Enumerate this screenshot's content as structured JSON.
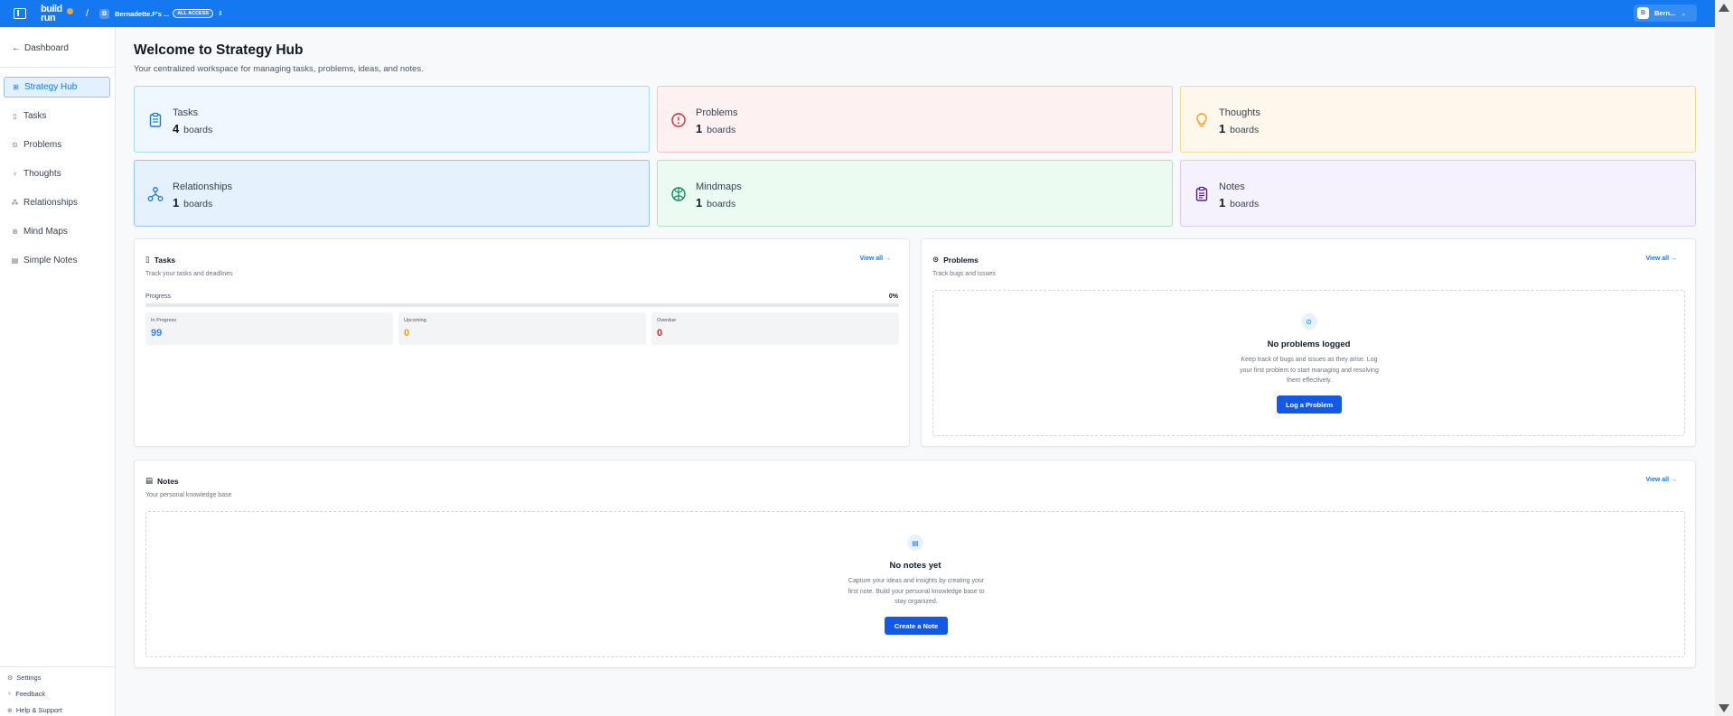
{
  "topbar": {
    "logo_line1": "build",
    "logo_line2": "run",
    "separator": "/",
    "workspace_initial": "B",
    "workspace_name": "Bernadette.F's ...",
    "workspace_badge": "ALL ACCESS",
    "user_initial": "B",
    "user_name": "Bern..."
  },
  "sidebar": {
    "back_label": "Dashboard",
    "items": [
      {
        "label": "Strategy Hub",
        "icon": "grid-icon",
        "active": true
      },
      {
        "label": "Tasks",
        "icon": "clipboard-icon"
      },
      {
        "label": "Problems",
        "icon": "alert-circle-icon"
      },
      {
        "label": "Thoughts",
        "icon": "lightbulb-icon"
      },
      {
        "label": "Relationships",
        "icon": "network-icon"
      },
      {
        "label": "Mind Maps",
        "icon": "brain-icon"
      },
      {
        "label": "Simple Notes",
        "icon": "note-icon"
      }
    ],
    "footer": [
      {
        "label": "Settings",
        "icon": "gear-icon"
      },
      {
        "label": "Feedback",
        "icon": "lightbulb-icon"
      },
      {
        "label": "Help & Support",
        "icon": "help-icon"
      }
    ]
  },
  "page": {
    "title": "Welcome to Strategy Hub",
    "subtitle": "Your centralized workspace for managing tasks, problems, ideas, and notes."
  },
  "stats": [
    {
      "label": "Tasks",
      "count": "4",
      "unit": "boards",
      "bg": "#eef8fe",
      "border": "#a9d8f5",
      "accent": "#1479f0"
    },
    {
      "label": "Problems",
      "count": "1",
      "unit": "boards",
      "bg": "#fef1f1",
      "border": "#f5c4c4",
      "accent": "#dc2626"
    },
    {
      "label": "Thoughts",
      "count": "1",
      "unit": "boards",
      "bg": "#fef8ec",
      "border": "#f6d79a",
      "accent": "#f59e0b"
    },
    {
      "label": "Relationships",
      "count": "1",
      "unit": "boards",
      "bg": "#e5f1fd",
      "border": "#94c3f0",
      "accent": "#1479f0"
    },
    {
      "label": "Mindmaps",
      "count": "1",
      "unit": "boards",
      "bg": "#ebfbf2",
      "border": "#a8e6c3",
      "accent": "#0f8a5a"
    },
    {
      "label": "Notes",
      "count": "1",
      "unit": "boards",
      "bg": "#f5f2fe",
      "border": "#d6cbf6",
      "accent": "#4c1d95"
    }
  ],
  "tasks_panel": {
    "title": "Tasks",
    "subtitle": "Track your tasks and deadlines",
    "view_all": "View all",
    "progress_label": "Progress",
    "progress_text": "0%",
    "progress_value": 0,
    "in_progress_label": "In Progress",
    "in_progress_value": "99",
    "upcoming_label": "Upcoming",
    "upcoming_value": "0",
    "overdue_label": "Overdue",
    "overdue_value": "0"
  },
  "problems_panel": {
    "title": "Problems",
    "subtitle": "Track bugs and issues",
    "view_all": "View all",
    "empty_title": "No problems logged",
    "empty_desc": "Keep track of bugs and issues as they arise. Log your first problem to start managing and resolving them effectively.",
    "button": "Log a Problem"
  },
  "notes_panel": {
    "title": "Notes",
    "subtitle": "Your personal knowledge base",
    "view_all": "View all",
    "empty_title": "No notes yet",
    "empty_desc": "Capture your ideas and insights by creating your first note. Build your personal knowledge base to stay organized.",
    "button": "Create a Note"
  }
}
